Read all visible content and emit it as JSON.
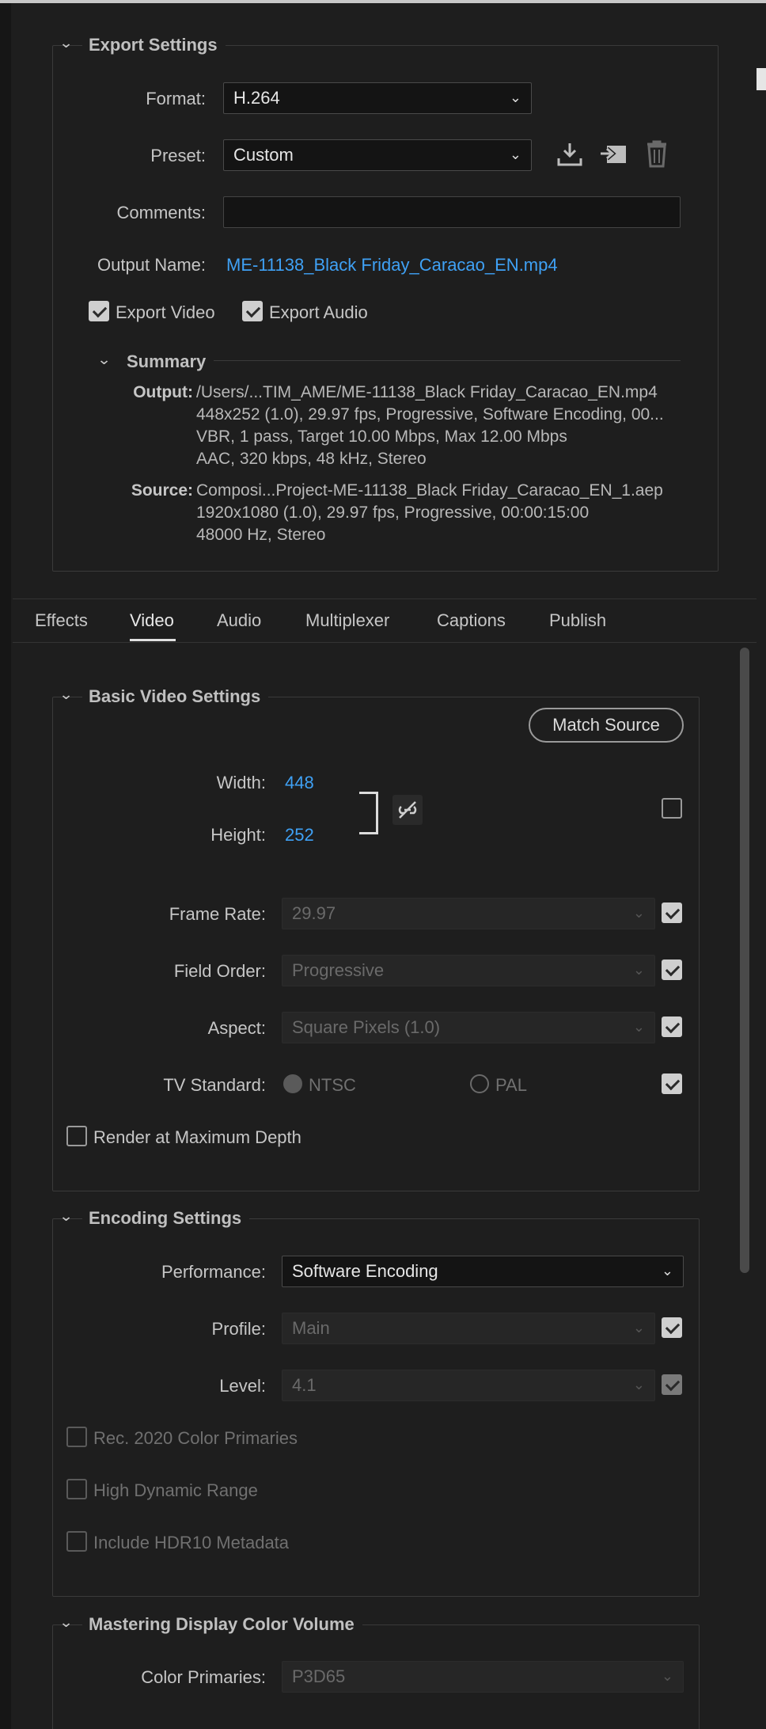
{
  "export": {
    "title": "Export Settings",
    "format_label": "Format:",
    "format_value": "H.264",
    "preset_label": "Preset:",
    "preset_value": "Custom",
    "comments_label": "Comments:",
    "output_name_label": "Output Name:",
    "output_name": "ME-11138_Black Friday_Caracao_EN.mp4",
    "export_video": "Export Video",
    "export_audio": "Export Audio",
    "summary_title": "Summary",
    "output_key": "Output:",
    "output_lines": [
      "/Users/...TIM_AME/ME-11138_Black Friday_Caracao_EN.mp4",
      "448x252 (1.0), 29.97 fps, Progressive, Software Encoding, 00...",
      "VBR, 1 pass, Target 10.00 Mbps, Max 12.00 Mbps",
      "AAC, 320 kbps, 48 kHz, Stereo"
    ],
    "source_key": "Source:",
    "source_lines": [
      "Composi...Project-ME-11138_Black Friday_Caracao_EN_1.aep",
      "1920x1080 (1.0), 29.97 fps, Progressive, 00:00:15:00",
      "48000 Hz, Stereo"
    ]
  },
  "tabs": [
    "Effects",
    "Video",
    "Audio",
    "Multiplexer",
    "Captions",
    "Publish"
  ],
  "active_tab": "Video",
  "basic": {
    "title": "Basic Video Settings",
    "match_source": "Match Source",
    "width_label": "Width:",
    "width_value": "448",
    "height_label": "Height:",
    "height_value": "252",
    "frame_rate_label": "Frame Rate:",
    "frame_rate_value": "29.97",
    "field_order_label": "Field Order:",
    "field_order_value": "Progressive",
    "aspect_label": "Aspect:",
    "aspect_value": "Square Pixels (1.0)",
    "tv_standard_label": "TV Standard:",
    "ntsc": "NTSC",
    "pal": "PAL",
    "render_max_depth": "Render at Maximum Depth"
  },
  "encoding": {
    "title": "Encoding Settings",
    "performance_label": "Performance:",
    "performance_value": "Software Encoding",
    "profile_label": "Profile:",
    "profile_value": "Main",
    "level_label": "Level:",
    "level_value": "4.1",
    "rec2020": "Rec. 2020 Color Primaries",
    "hdr": "High Dynamic Range",
    "hdr10": "Include HDR10 Metadata"
  },
  "mastering": {
    "title": "Mastering Display Color Volume",
    "color_primaries_label": "Color Primaries:",
    "color_primaries_value": "P3D65"
  },
  "colors": {
    "link": "#3fa1f5",
    "background": "#1e1e1e"
  }
}
